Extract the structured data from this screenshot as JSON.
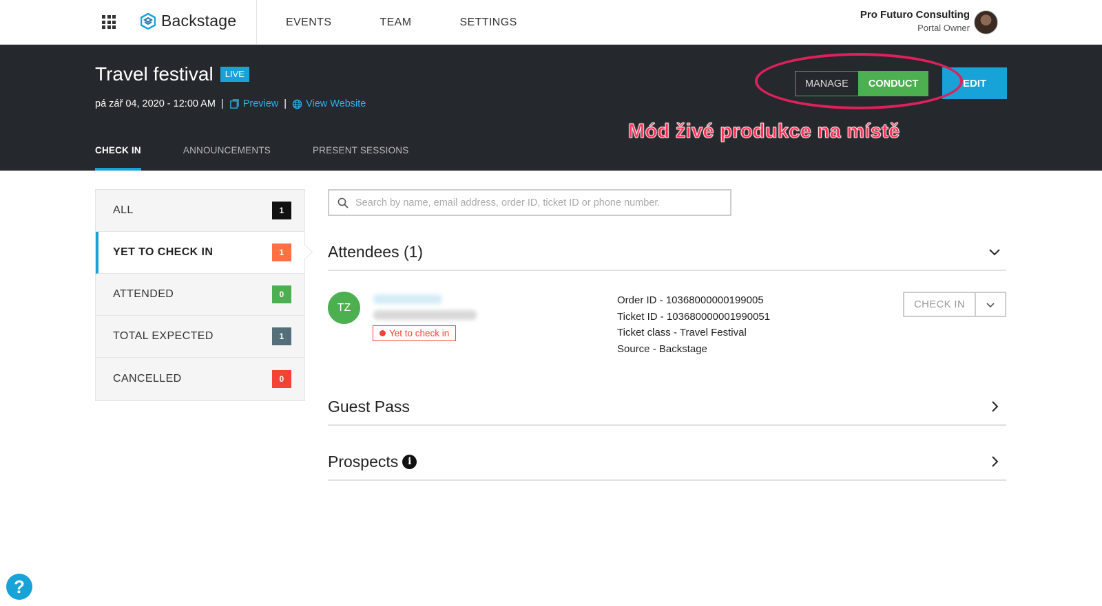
{
  "topnav": {
    "brand": "Backstage",
    "links": [
      "EVENTS",
      "TEAM",
      "SETTINGS"
    ],
    "user_name": "Pro Futuro Consulting",
    "user_role": "Portal Owner"
  },
  "event": {
    "title": "Travel festival",
    "status_badge": "LIVE",
    "datetime": "pá zář 04, 2020 - 12:00 AM",
    "separator": "|",
    "preview_link": "Preview",
    "website_link": "View Website",
    "mode_manage": "MANAGE",
    "mode_conduct": "CONDUCT",
    "edit_button": "EDIT",
    "annotation": "Mód živé produkce na místě",
    "tabs": [
      "CHECK IN",
      "ANNOUNCEMENTS",
      "PRESENT SESSIONS"
    ]
  },
  "filters": [
    {
      "label": "ALL",
      "count": "1",
      "color": "#111111"
    },
    {
      "label": "YET TO CHECK IN",
      "count": "1",
      "color": "#ff7043"
    },
    {
      "label": "ATTENDED",
      "count": "0",
      "color": "#4caf50"
    },
    {
      "label": "TOTAL EXPECTED",
      "count": "1",
      "color": "#546e7a"
    },
    {
      "label": "CANCELLED",
      "count": "0",
      "color": "#f44336"
    }
  ],
  "search": {
    "placeholder": "Search by name, email address, order ID, ticket ID or phone number."
  },
  "attendees": {
    "title": "Attendees (1)",
    "items": [
      {
        "initials": "TZ",
        "status": "Yet to check in",
        "order_id": "Order ID - 10368000000199005",
        "ticket_id": "Ticket ID - 103680000001990051",
        "ticket_class": "Ticket class - Travel Festival",
        "source": "Source - Backstage",
        "action": "CHECK IN"
      }
    ]
  },
  "guest_pass": {
    "title": "Guest Pass"
  },
  "prospects": {
    "title": "Prospects",
    "info_icon": "i"
  },
  "help": {
    "label": "?"
  },
  "colors": {
    "accent": "#17a2d8",
    "conduct": "#4caf50",
    "header_bg": "#25282c",
    "annotation": "#ff2f55"
  }
}
